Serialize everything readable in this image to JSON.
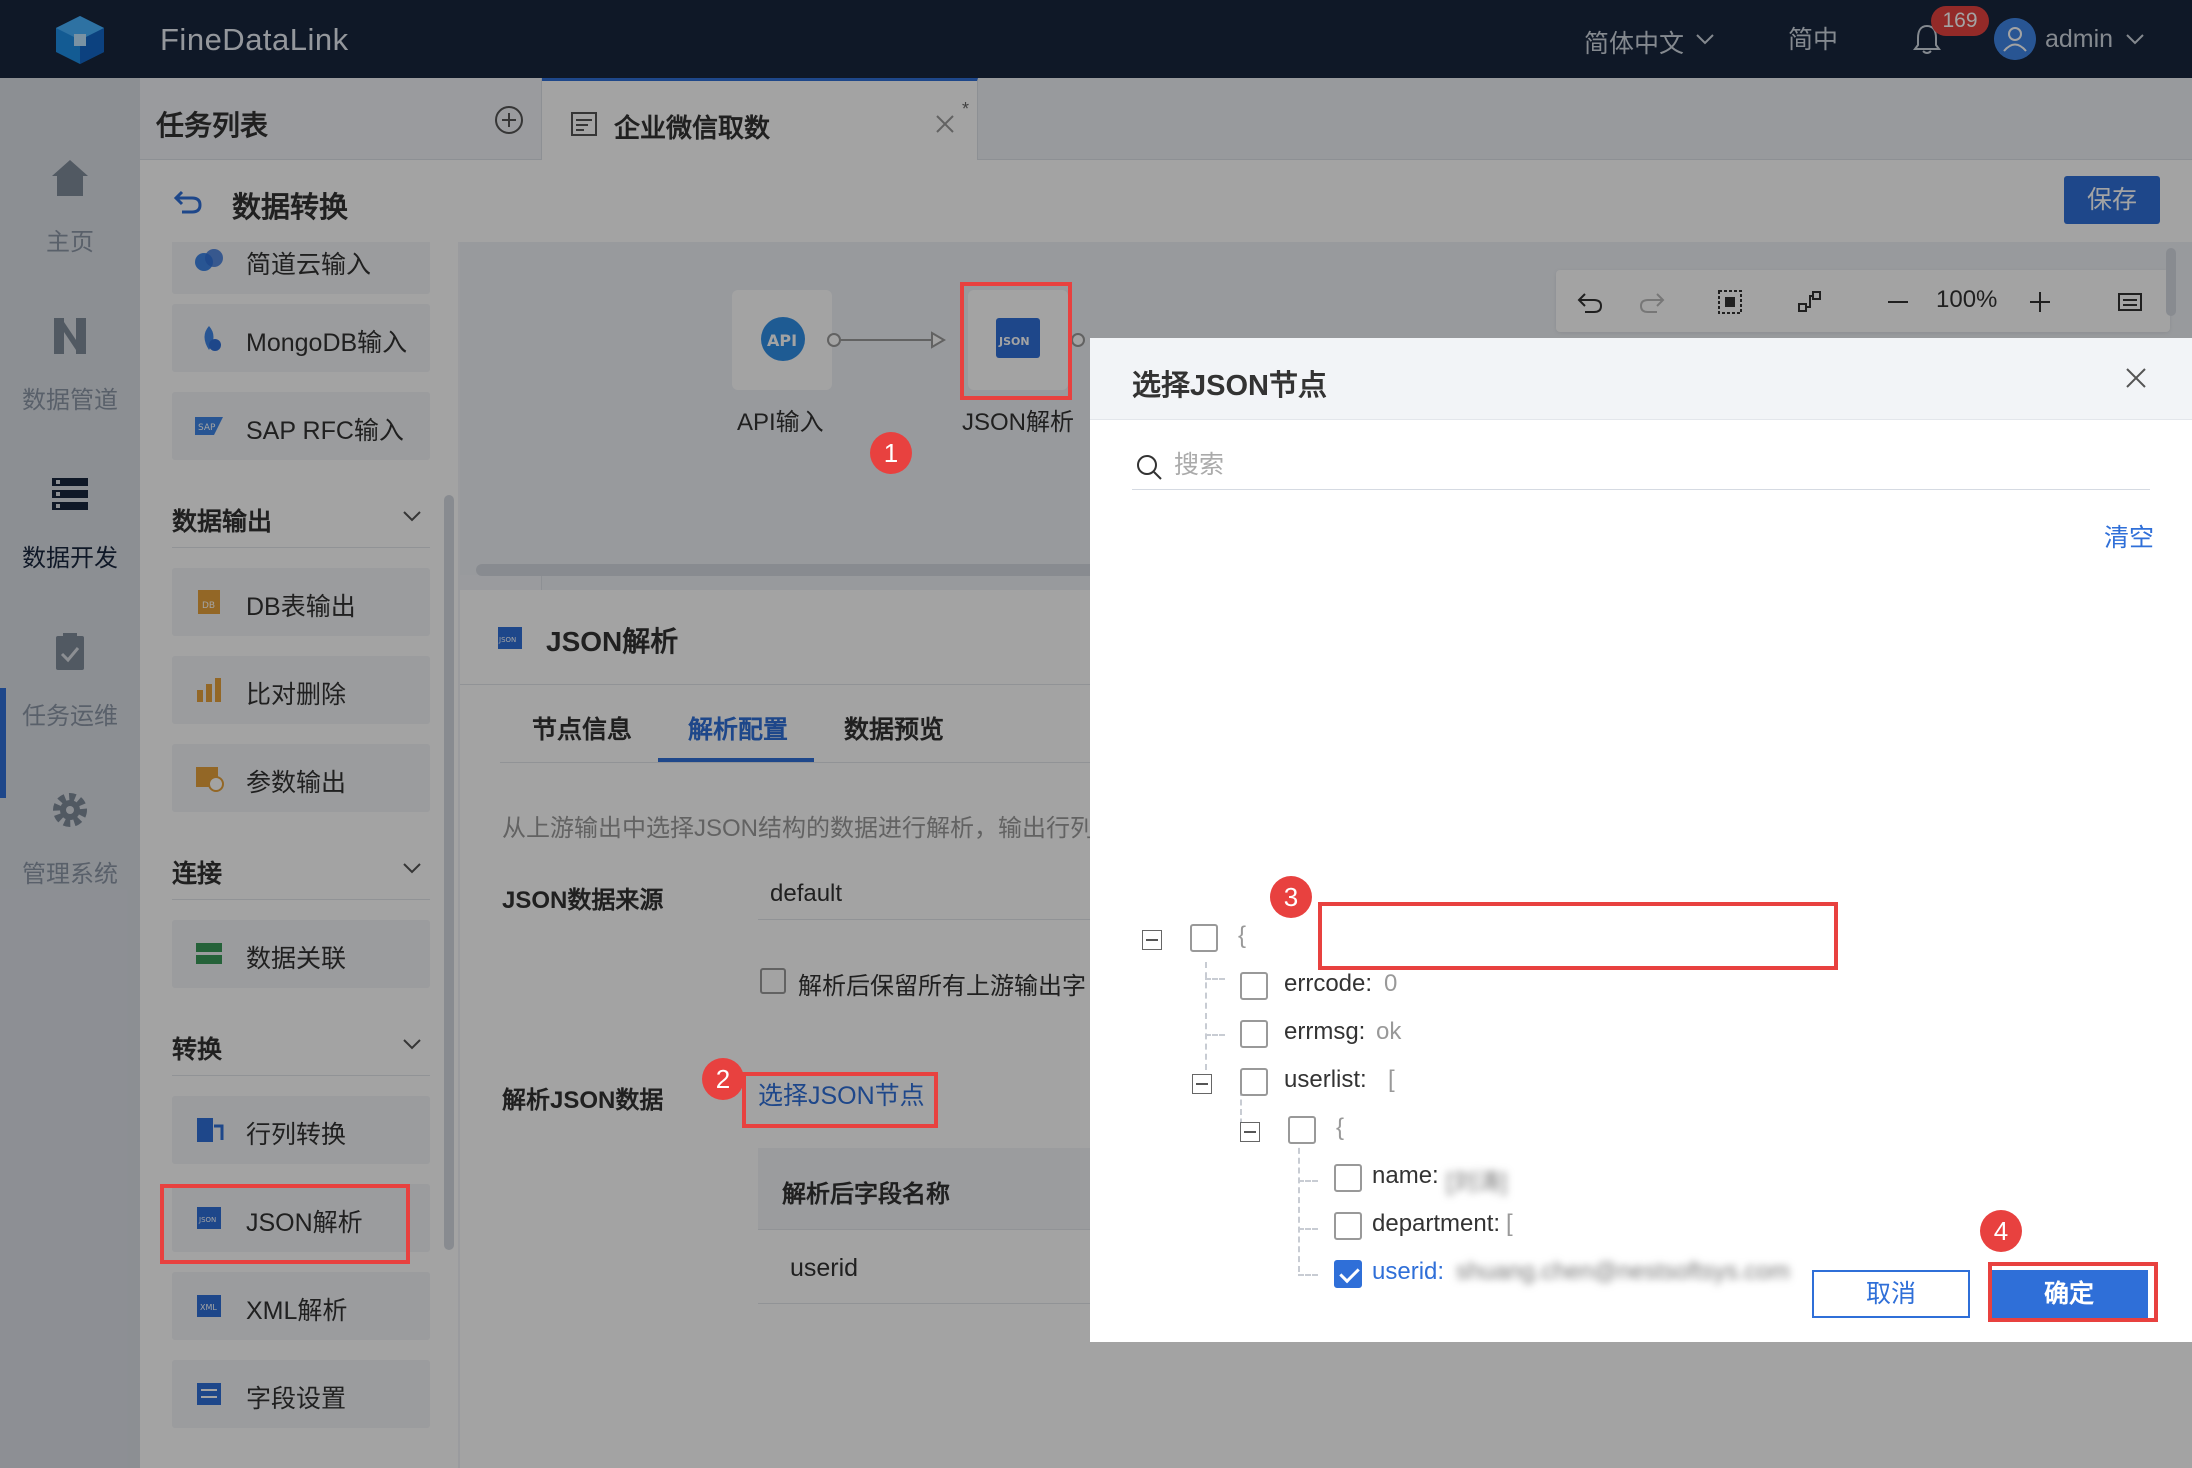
{
  "app": {
    "brand": "FineDataLink"
  },
  "topbar": {
    "language": "简体中文",
    "short_language": "简中",
    "notifications": "169",
    "user": "admin"
  },
  "leftnav": {
    "items": [
      {
        "label": "主页",
        "icon": "home-icon"
      },
      {
        "label": "数据管道",
        "icon": "pipeline-icon"
      },
      {
        "label": "数据开发",
        "icon": "data-dev-icon"
      },
      {
        "label": "任务运维",
        "icon": "task-ops-icon"
      },
      {
        "label": "管理系统",
        "icon": "gear-icon"
      }
    ],
    "active": "数据开发"
  },
  "tasks": {
    "title": "任务列表",
    "open_tab": "企业微信取数"
  },
  "subheader": {
    "title": "数据转换",
    "save": "保存"
  },
  "palette": {
    "items": [
      {
        "label": "简道云输入"
      },
      {
        "label": "MongoDB输入"
      },
      {
        "label": "SAP RFC输入"
      },
      {
        "label": "DB表输出"
      },
      {
        "label": "比对删除"
      },
      {
        "label": "参数输出"
      },
      {
        "label": "数据关联"
      },
      {
        "label": "行列转换"
      },
      {
        "label": "JSON解析"
      },
      {
        "label": "XML解析"
      },
      {
        "label": "字段设置"
      }
    ],
    "groups": [
      {
        "label": "数据输出"
      },
      {
        "label": "连接"
      },
      {
        "label": "转换"
      }
    ]
  },
  "canvas": {
    "nodes": [
      {
        "label": "API输入",
        "icon_text": "API"
      },
      {
        "label": "JSON解析",
        "icon_text": "JSON"
      }
    ],
    "zoom": "100%"
  },
  "config": {
    "title": "JSON解析",
    "tabs": [
      {
        "label": "节点信息"
      },
      {
        "label": "解析配置"
      },
      {
        "label": "数据预览"
      }
    ],
    "active_tab": "解析配置",
    "description": "从上游输出中选择JSON结构的数据进行解析，输出行列",
    "source_label": "JSON数据来源",
    "source_value": "default",
    "keep_fields_label": "解析后保留所有上游输出字",
    "parse_label": "解析JSON数据",
    "select_link": "选择JSON节点",
    "table_header": "解析后字段名称",
    "table_rows": [
      "userid"
    ]
  },
  "dialog": {
    "title": "选择JSON节点",
    "search_placeholder": "搜索",
    "clear": "清空",
    "tree": [
      {
        "key": "{",
        "value": "",
        "checked": false
      },
      {
        "key": "errcode:",
        "value": "0",
        "checked": false
      },
      {
        "key": "errmsg:",
        "value": "ok",
        "checked": false
      },
      {
        "key": "userlist:",
        "value": "[",
        "checked": false
      },
      {
        "key": "{",
        "value": "",
        "checked": false
      },
      {
        "key": "name:",
        "value": "[刘涛]",
        "checked": false
      },
      {
        "key": "department:",
        "value": "[",
        "checked": false
      },
      {
        "key": "userid:",
        "value": "shuang.chen@nestsoftsys.com",
        "checked": true
      }
    ],
    "cancel": "取消",
    "confirm": "确定"
  },
  "annotations": [
    "1",
    "2",
    "3",
    "4"
  ],
  "colors": {
    "accent": "#2f6fd8",
    "topbar": "#18263d",
    "annotation": "#e8413f"
  }
}
